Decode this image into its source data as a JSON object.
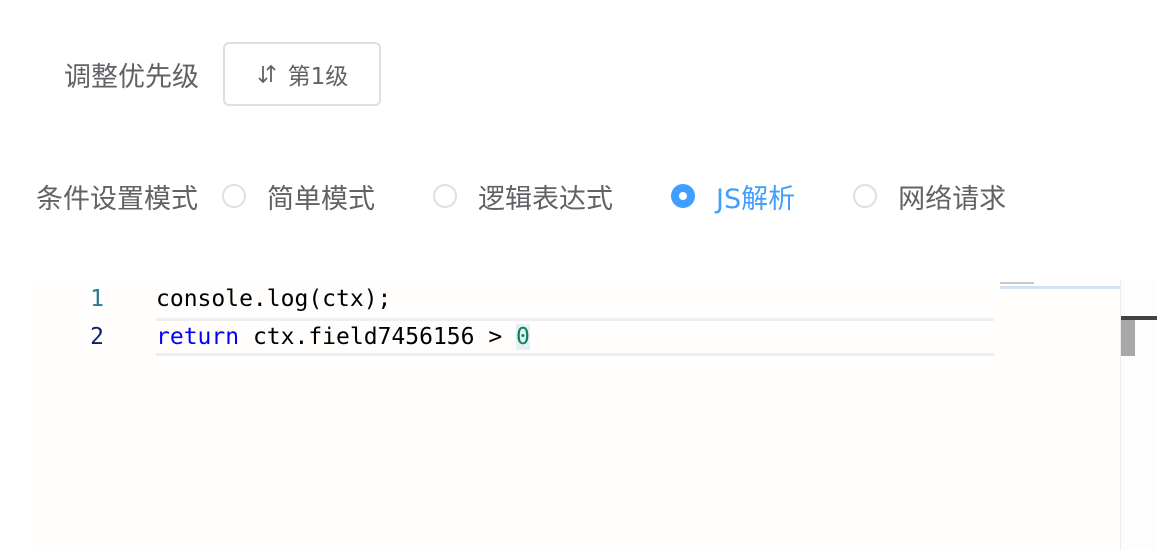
{
  "priority": {
    "label": "调整优先级",
    "button_label": "第1级",
    "button_icon": "sort-icon"
  },
  "condition_mode": {
    "label": "条件设置模式",
    "options": [
      {
        "label": "简单模式",
        "checked": false
      },
      {
        "label": "逻辑表达式",
        "checked": false
      },
      {
        "label": "JS解析",
        "checked": true
      },
      {
        "label": "网络请求",
        "checked": false
      }
    ]
  },
  "editor": {
    "lines": [
      {
        "number": "1",
        "code": "console.log(ctx);"
      },
      {
        "number": "2",
        "keyword": "return",
        "code": " ctx.field7456156 > ",
        "literal": "0"
      }
    ]
  },
  "colors": {
    "accent": "#409eff",
    "text": "#606266",
    "border": "#dcdfe6",
    "keyword": "#0000ff",
    "number": "#098658",
    "line_number": "#237893"
  }
}
